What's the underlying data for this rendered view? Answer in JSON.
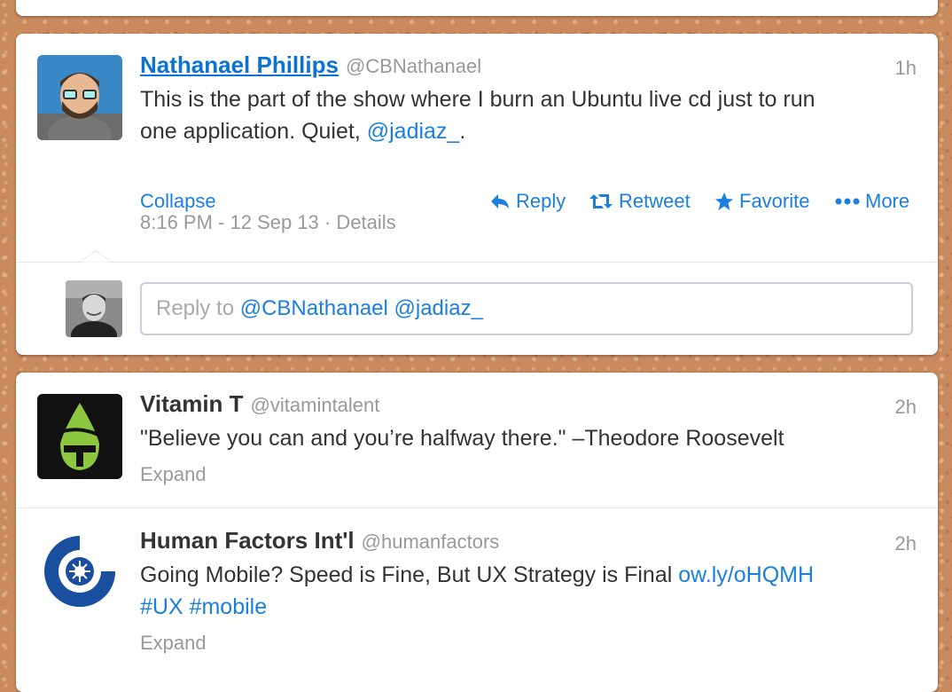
{
  "tweets": [
    {
      "name": "Nathanael Phillips",
      "handle": "@CBNathanael",
      "time": "1h",
      "text_line1": "This is the part of the show where I burn an Ubuntu live cd just to run",
      "text_line2_prefix": "one application. Quiet, ",
      "text_line2_mention": "@jadiaz_",
      "text_line2_suffix": ".",
      "collapse_label": "Collapse",
      "actions": {
        "reply": "Reply",
        "retweet": "Retweet",
        "favorite": "Favorite",
        "more": "More"
      },
      "timestamp": "8:16 PM - 12 Sep 13",
      "details_label": "Details",
      "reply_prefix": "Reply to ",
      "reply_mentions": "@CBNathanael @jadiaz_"
    },
    {
      "name": "Vitamin T",
      "handle": "@vitamintalent",
      "time": "2h",
      "text": "\"Believe you can and you’re halfway there.\"  –Theodore Roosevelt",
      "expand_label": "Expand"
    },
    {
      "name": "Human Factors Int'l",
      "handle": "@humanfactors",
      "time": "2h",
      "text_prefix": "Going Mobile? Speed is Fine, But UX Strategy is Final ",
      "link": "ow.ly/oHQMH",
      "hashtags": "#UX #mobile",
      "expand_label": "Expand"
    }
  ],
  "colors": {
    "link": "#1b7fe0",
    "muted": "#999999",
    "text": "#333333"
  },
  "icons": [
    "reply-icon",
    "retweet-icon",
    "favorite-icon",
    "more-icon"
  ]
}
